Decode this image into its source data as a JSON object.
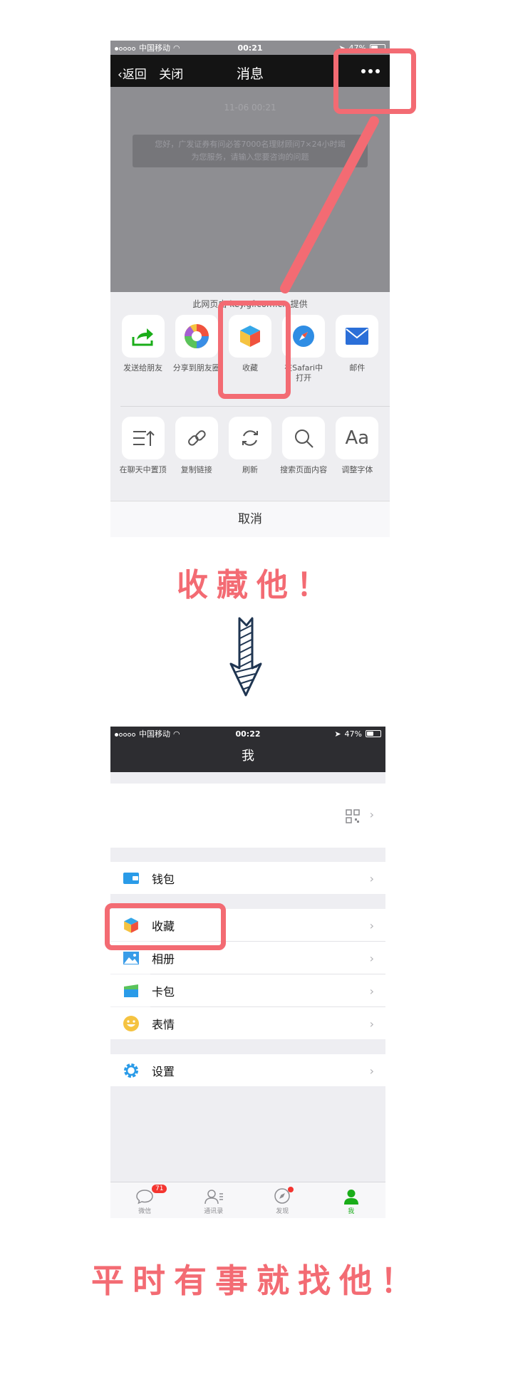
{
  "phone1": {
    "status": {
      "carrier": "中国移动",
      "time": "00:21",
      "battery": "47%"
    },
    "nav": {
      "back": "返回",
      "close": "关闭",
      "title": "消息"
    },
    "chat": {
      "time": "11-06 00:21",
      "message_line1": "您好，广发证券有问必答7000名理财顾问7×24小时竭",
      "message_line2": "为您服务，请输入您要咨询的问题"
    },
    "sheet": {
      "provider": "此网页由 key.gf.com.cn 提供",
      "row1": [
        {
          "label": "发送给朋友",
          "icon": "share-arrow-icon"
        },
        {
          "label": "分享到朋友圈",
          "icon": "moments-icon"
        },
        {
          "label": "收藏",
          "icon": "favorites-cube-icon"
        },
        {
          "label": "在Safari中\n打开",
          "icon": "safari-compass-icon"
        },
        {
          "label": "邮件",
          "icon": "mail-icon"
        }
      ],
      "row2": [
        {
          "label": "在聊天中置顶",
          "icon": "pin-top-icon"
        },
        {
          "label": "复制链接",
          "icon": "link-icon"
        },
        {
          "label": "刷新",
          "icon": "refresh-icon"
        },
        {
          "label": "搜索页面内容",
          "icon": "search-icon"
        },
        {
          "label": "调整字体",
          "icon": "font-size-icon"
        }
      ],
      "cancel": "取消"
    }
  },
  "caption1": "收藏他！",
  "caption2": "平时有事就找他！",
  "phone2": {
    "status": {
      "carrier": "中国移动",
      "time": "00:22",
      "battery": "47%"
    },
    "nav": {
      "title": "我"
    },
    "menu": {
      "wallet": "钱包",
      "favorites": "收藏",
      "album": "相册",
      "cards": "卡包",
      "stickers": "表情",
      "settings": "设置"
    },
    "tabs": [
      {
        "label": "微信",
        "badge": "71"
      },
      {
        "label": "通讯录"
      },
      {
        "label": "发现"
      },
      {
        "label": "我"
      }
    ]
  },
  "colors": {
    "highlight": "#f36b73",
    "wechat_green": "#1aad19",
    "badge_red": "#f43530",
    "arrow_navy": "#1f3551"
  }
}
